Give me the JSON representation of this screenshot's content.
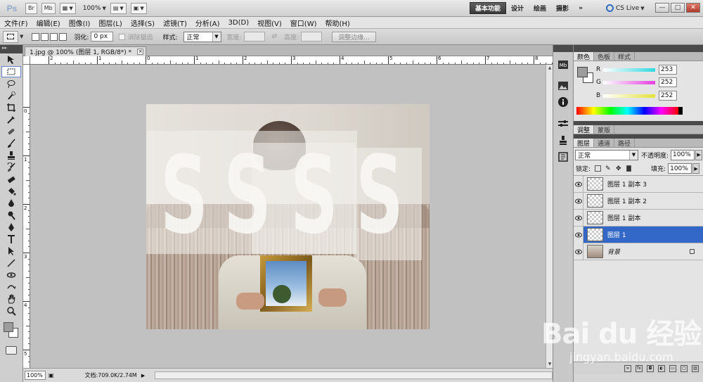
{
  "app": {
    "logo": "Ps",
    "bridge_label": "Br",
    "minibridge_label": "Mb",
    "zoom_value": "100%",
    "workspaces": [
      "基本功能",
      "设计",
      "绘画",
      "摄影"
    ],
    "workspace_more": "»",
    "cs_live": "CS Live",
    "window_buttons": [
      "—",
      "□",
      "✕"
    ]
  },
  "menu": [
    "文件(F)",
    "编辑(E)",
    "图像(I)",
    "图层(L)",
    "选择(S)",
    "滤镜(T)",
    "分析(A)",
    "3D(D)",
    "视图(V)",
    "窗口(W)",
    "帮助(H)"
  ],
  "options": {
    "feather_label": "羽化:",
    "feather_value": "0 px",
    "antialias_label": "消除锯齿",
    "style_label": "样式:",
    "style_value": "正常",
    "width_label": "宽度:",
    "height_label": "高度:",
    "refine_edge": "调整边缘..."
  },
  "document": {
    "tab_title": "1.jpg @ 100% (图层 1, RGB/8*) *",
    "close_glyph": "×",
    "ruler_top_labels": [
      "2",
      "1",
      "0",
      "1",
      "2",
      "3",
      "4",
      "5",
      "6",
      "7",
      "8"
    ],
    "ruler_left_labels": [
      "0",
      "1",
      "2",
      "3",
      "4",
      "5"
    ],
    "zoom": "100%",
    "doc_size": "文档:709.0K/2.74M",
    "canvas_text": [
      "S",
      "S",
      "S",
      "S"
    ]
  },
  "panels": {
    "color_tabs": [
      "颜色",
      "色板",
      "样式"
    ],
    "color": {
      "channels": [
        {
          "label": "R",
          "value": "253",
          "gradient": "#2ed8e0"
        },
        {
          "label": "G",
          "value": "252",
          "gradient": "#e33fe0"
        },
        {
          "label": "B",
          "value": "252",
          "gradient": "#e4e23a"
        }
      ]
    },
    "adjust_tabs": [
      "调整",
      "蒙版"
    ],
    "layer_tabs": [
      "图层",
      "通道",
      "路径"
    ],
    "blend_mode": "正常",
    "opacity_label": "不透明度:",
    "opacity_value": "100%",
    "lock_label": "锁定:",
    "fill_label": "填充:",
    "fill_value": "100%",
    "layers": [
      {
        "name": "图层 1 副本 3",
        "selected": false
      },
      {
        "name": "图层 1 副本 2",
        "selected": false
      },
      {
        "name": "图层 1 副本",
        "selected": false
      },
      {
        "name": "图层 1",
        "selected": true
      },
      {
        "name": "背景",
        "selected": false
      }
    ]
  },
  "watermark": {
    "main": "Bai du 经验",
    "sub": "jingyan.baidu.com"
  }
}
